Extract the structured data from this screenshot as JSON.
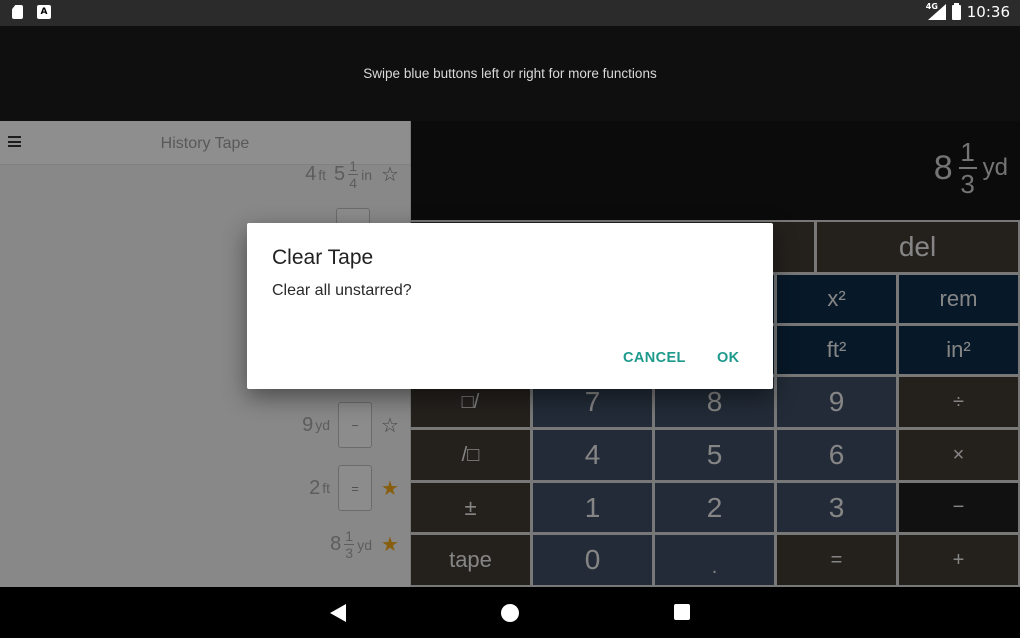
{
  "status_bar": {
    "time": "10:36",
    "network": "4G",
    "left_icons": [
      "sd-card-icon",
      "a-notification-icon"
    ],
    "a_icon_text": "A"
  },
  "hint": "Swipe blue buttons left or right for more functions",
  "history": {
    "title": "History Tape",
    "rows": [
      {
        "whole": "4",
        "unit1": "ft",
        "num2": "5",
        "frac_num": "1",
        "frac_den": "4",
        "unit2": "in",
        "op": "",
        "starred": false
      },
      {
        "op": "−",
        "whole": "9",
        "unit": "yd",
        "starred": false
      },
      {
        "op": "=",
        "whole": "2",
        "unit": "ft",
        "starred": true
      },
      {
        "whole": "8",
        "frac_num": "1",
        "frac_den": "3",
        "unit": "yd",
        "starred": true
      }
    ],
    "star_glyph_on": "★",
    "star_glyph_off": "☆"
  },
  "display": {
    "whole": "8",
    "frac_num": "1",
    "frac_den": "3",
    "unit": "yd"
  },
  "keypad": {
    "del": "del",
    "x2": "x²",
    "rem": "rem",
    "ft2": "ft²",
    "in2": "in²",
    "box_slash": "□/",
    "slash_box": "/□",
    "plusminus": "±",
    "tape": "tape",
    "d7": "7",
    "d8": "8",
    "d9": "9",
    "d4": "4",
    "d5": "5",
    "d6": "6",
    "d1": "1",
    "d2": "2",
    "d3": "3",
    "d0": "0",
    "dot": ".",
    "equals": "=",
    "divide": "÷",
    "multiply": "×",
    "minus": "−",
    "plus": "+"
  },
  "dialog": {
    "title": "Clear Tape",
    "message": "Clear all unstarred?",
    "cancel": "CANCEL",
    "ok": "OK"
  },
  "colors": {
    "accent": "#1e9a8c",
    "star": "#e8a317",
    "fn_key": "#0d2a46",
    "num_key": "#3b4a5f"
  }
}
